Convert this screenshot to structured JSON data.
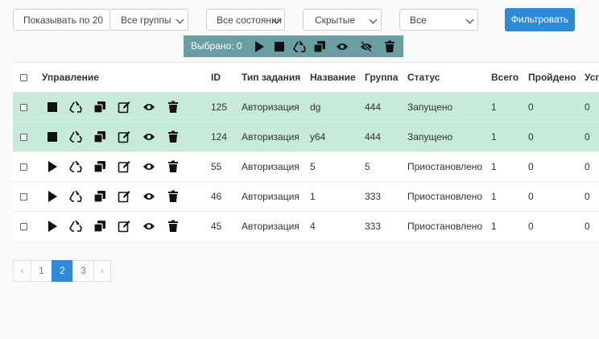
{
  "filters": {
    "per_page": "Показывать по 20",
    "groups": "Все группы",
    "states": "Все состояния",
    "hidden": "Скрытые",
    "all": "Все",
    "filter_button": "Фильтровать"
  },
  "bulk": {
    "selected_label": "Выбрано: 0"
  },
  "table": {
    "headers": {
      "manage": "Управление",
      "id": "ID",
      "task_type": "Тип задания",
      "name": "Название",
      "group": "Группа",
      "status": "Статус",
      "total": "Всего",
      "passed": "Пройдено",
      "success": "Успешно"
    },
    "rows": [
      {
        "id": "125",
        "type": "Авторизация",
        "name": "dg",
        "group": "444",
        "status": "Запущено",
        "total": "1",
        "passed": "0",
        "success": "0",
        "running": true
      },
      {
        "id": "124",
        "type": "Авторизация",
        "name": "y64",
        "group": "444",
        "status": "Запущено",
        "total": "1",
        "passed": "0",
        "success": "0",
        "running": true
      },
      {
        "id": "55",
        "type": "Авторизация",
        "name": "5",
        "group": "5",
        "status": "Приостановлено",
        "total": "1",
        "passed": "0",
        "success": "0",
        "running": false
      },
      {
        "id": "46",
        "type": "Авторизация",
        "name": "1",
        "group": "333",
        "status": "Приостановлено",
        "total": "1",
        "passed": "0",
        "success": "0",
        "running": false
      },
      {
        "id": "45",
        "type": "Авторизация",
        "name": "4",
        "group": "333",
        "status": "Приостановлено",
        "total": "1",
        "passed": "0",
        "success": "0",
        "running": false
      }
    ]
  },
  "pagination": {
    "prev": "‹",
    "pages": [
      "1",
      "2",
      "3"
    ],
    "current": "2",
    "next": "›"
  },
  "colors": {
    "accent": "#2d8ad8",
    "bulk_bar": "#6a9ea3",
    "running_row": "#c7ebd8"
  }
}
